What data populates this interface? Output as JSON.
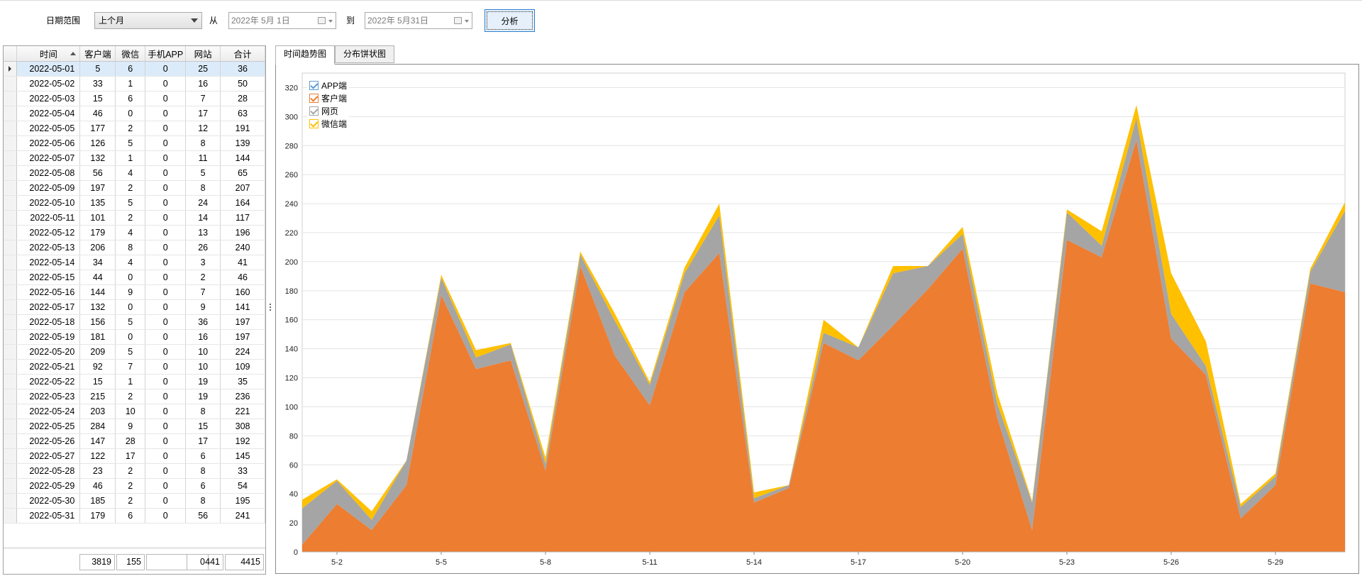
{
  "filter": {
    "range_label": "日期范围",
    "range_value": "上个月",
    "from_label": "从",
    "from_date": "2022年  5月  1日",
    "to_label": "到",
    "to_date": "2022年  5月31日",
    "analyze_label": "分析"
  },
  "table": {
    "headers": [
      "时间",
      "客户端",
      "微信",
      "手机APP",
      "网站",
      "合计"
    ],
    "rows": [
      [
        "2022-05-01",
        "5",
        "6",
        "0",
        "25",
        "36"
      ],
      [
        "2022-05-02",
        "33",
        "1",
        "0",
        "16",
        "50"
      ],
      [
        "2022-05-03",
        "15",
        "6",
        "0",
        "7",
        "28"
      ],
      [
        "2022-05-04",
        "46",
        "0",
        "0",
        "17",
        "63"
      ],
      [
        "2022-05-05",
        "177",
        "2",
        "0",
        "12",
        "191"
      ],
      [
        "2022-05-06",
        "126",
        "5",
        "0",
        "8",
        "139"
      ],
      [
        "2022-05-07",
        "132",
        "1",
        "0",
        "11",
        "144"
      ],
      [
        "2022-05-08",
        "56",
        "4",
        "0",
        "5",
        "65"
      ],
      [
        "2022-05-09",
        "197",
        "2",
        "0",
        "8",
        "207"
      ],
      [
        "2022-05-10",
        "135",
        "5",
        "0",
        "24",
        "164"
      ],
      [
        "2022-05-11",
        "101",
        "2",
        "0",
        "14",
        "117"
      ],
      [
        "2022-05-12",
        "179",
        "4",
        "0",
        "13",
        "196"
      ],
      [
        "2022-05-13",
        "206",
        "8",
        "0",
        "26",
        "240"
      ],
      [
        "2022-05-14",
        "34",
        "4",
        "0",
        "3",
        "41"
      ],
      [
        "2022-05-15",
        "44",
        "0",
        "0",
        "2",
        "46"
      ],
      [
        "2022-05-16",
        "144",
        "9",
        "0",
        "7",
        "160"
      ],
      [
        "2022-05-17",
        "132",
        "0",
        "0",
        "9",
        "141"
      ],
      [
        "2022-05-18",
        "156",
        "5",
        "0",
        "36",
        "197"
      ],
      [
        "2022-05-19",
        "181",
        "0",
        "0",
        "16",
        "197"
      ],
      [
        "2022-05-20",
        "209",
        "5",
        "0",
        "10",
        "224"
      ],
      [
        "2022-05-21",
        "92",
        "7",
        "0",
        "10",
        "109"
      ],
      [
        "2022-05-22",
        "15",
        "1",
        "0",
        "19",
        "35"
      ],
      [
        "2022-05-23",
        "215",
        "2",
        "0",
        "19",
        "236"
      ],
      [
        "2022-05-24",
        "203",
        "10",
        "0",
        "8",
        "221"
      ],
      [
        "2022-05-25",
        "284",
        "9",
        "0",
        "15",
        "308"
      ],
      [
        "2022-05-26",
        "147",
        "28",
        "0",
        "17",
        "192"
      ],
      [
        "2022-05-27",
        "122",
        "17",
        "0",
        "6",
        "145"
      ],
      [
        "2022-05-28",
        "23",
        "2",
        "0",
        "8",
        "33"
      ],
      [
        "2022-05-29",
        "46",
        "2",
        "0",
        "6",
        "54"
      ],
      [
        "2022-05-30",
        "185",
        "2",
        "0",
        "8",
        "195"
      ],
      [
        "2022-05-31",
        "179",
        "6",
        "0",
        "56",
        "241"
      ]
    ],
    "totals": [
      "3819",
      "155",
      "0",
      "441",
      "4415"
    ]
  },
  "tabs": [
    {
      "label": "时间趋势图",
      "active": true
    },
    {
      "label": "分布饼状图",
      "active": false
    }
  ],
  "chart_data": {
    "type": "area",
    "stacked": true,
    "x": [
      "2022-05-01",
      "2022-05-02",
      "2022-05-03",
      "2022-05-04",
      "2022-05-05",
      "2022-05-06",
      "2022-05-07",
      "2022-05-08",
      "2022-05-09",
      "2022-05-10",
      "2022-05-11",
      "2022-05-12",
      "2022-05-13",
      "2022-05-14",
      "2022-05-15",
      "2022-05-16",
      "2022-05-17",
      "2022-05-18",
      "2022-05-19",
      "2022-05-20",
      "2022-05-21",
      "2022-05-22",
      "2022-05-23",
      "2022-05-24",
      "2022-05-25",
      "2022-05-26",
      "2022-05-27",
      "2022-05-28",
      "2022-05-29",
      "2022-05-30",
      "2022-05-31"
    ],
    "x_ticks": [
      "5-2",
      "5-5",
      "5-8",
      "5-11",
      "5-14",
      "5-17",
      "5-20",
      "5-23",
      "5-26",
      "5-29"
    ],
    "y_ticks": [
      "0",
      "20",
      "40",
      "60",
      "80",
      "100",
      "120",
      "140",
      "160",
      "180",
      "200",
      "220",
      "240",
      "260",
      "280",
      "300",
      "320"
    ],
    "ylim": [
      0,
      330
    ],
    "grid": true,
    "legend_position": "top-left",
    "series": [
      {
        "name": "客户端",
        "color": "#ed7d31",
        "values": [
          5,
          33,
          15,
          46,
          177,
          126,
          132,
          56,
          197,
          135,
          101,
          179,
          206,
          34,
          44,
          144,
          132,
          156,
          181,
          209,
          92,
          15,
          215,
          203,
          284,
          147,
          122,
          23,
          46,
          185,
          179
        ]
      },
      {
        "name": "网页",
        "color": "#a5a5a5",
        "values": [
          25,
          16,
          7,
          17,
          12,
          8,
          11,
          5,
          8,
          24,
          14,
          13,
          26,
          3,
          2,
          7,
          9,
          36,
          16,
          10,
          10,
          19,
          19,
          8,
          15,
          17,
          6,
          8,
          6,
          8,
          56
        ]
      },
      {
        "name": "微信端",
        "color": "#ffc000",
        "values": [
          6,
          1,
          6,
          0,
          2,
          5,
          1,
          4,
          2,
          5,
          2,
          4,
          8,
          4,
          0,
          9,
          0,
          5,
          0,
          5,
          7,
          1,
          2,
          10,
          9,
          28,
          17,
          2,
          2,
          2,
          6
        ]
      },
      {
        "name": "APP端",
        "color": "#5b9bd5",
        "values": [
          0,
          0,
          0,
          0,
          0,
          0,
          0,
          0,
          0,
          0,
          0,
          0,
          0,
          0,
          0,
          0,
          0,
          0,
          0,
          0,
          0,
          0,
          0,
          0,
          0,
          0,
          0,
          0,
          0,
          0,
          0
        ]
      }
    ],
    "legend": [
      {
        "name": "APP端",
        "color": "#5b9bd5"
      },
      {
        "name": "客户端",
        "color": "#ed7d31"
      },
      {
        "name": "网页",
        "color": "#a5a5a5"
      },
      {
        "name": "微信端",
        "color": "#ffc000"
      }
    ]
  }
}
